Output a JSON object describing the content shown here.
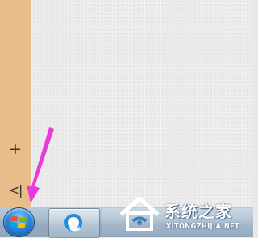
{
  "side_panel": {
    "add_label": "+",
    "collapse_label": "<|",
    "background": "#e9bd8a"
  },
  "annotation": {
    "arrow_color": "#e83ad8",
    "points_to": "start-button"
  },
  "taskbar": {
    "start_icon": "windows-logo-icon",
    "pinned_app_icon": "app-icon"
  },
  "watermark": {
    "title": "系统之家",
    "url": "XITONGZHIJIA.NET"
  }
}
